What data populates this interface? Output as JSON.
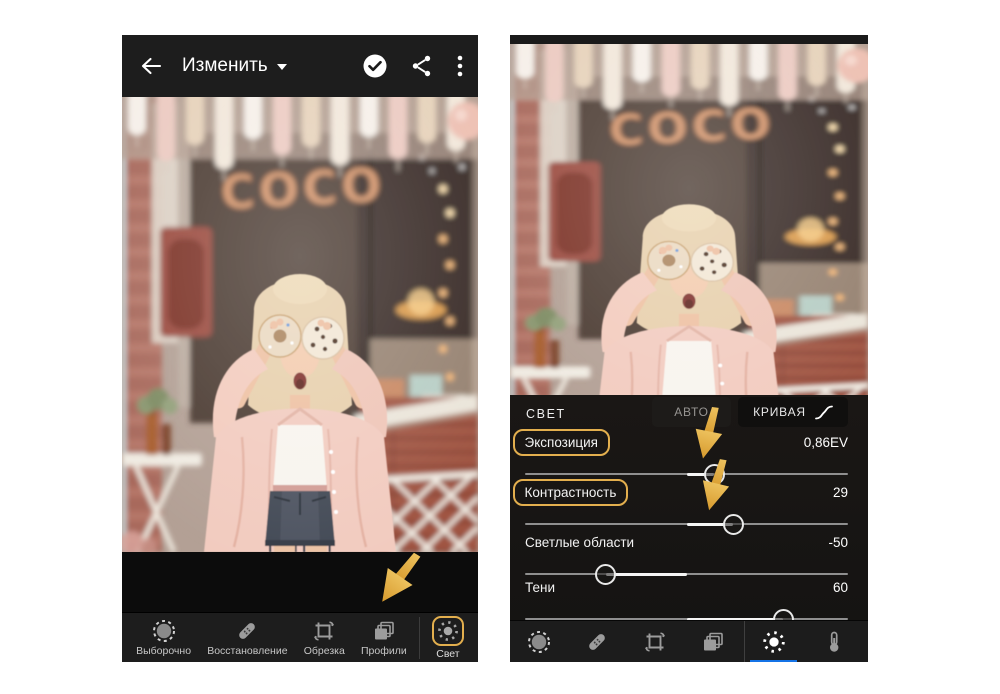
{
  "colors": {
    "accent_gold": "#E3AF4E",
    "selection_blue": "#1473E6"
  },
  "photo": {
    "sign_text": "COCO"
  },
  "left_phone": {
    "top_bar": {
      "title": "Изменить"
    },
    "toolbar": {
      "items": [
        {
          "label": "Выборочно"
        },
        {
          "label": "Восстановление"
        },
        {
          "label": "Обрезка"
        },
        {
          "label": "Профили"
        },
        {
          "label": "Свет",
          "selected": true
        }
      ]
    }
  },
  "right_phone": {
    "panel": {
      "title": "СВЕТ",
      "auto_label": "АВТО",
      "curve_label": "КРИВАЯ",
      "sliders": [
        {
          "label": "Экспозиция",
          "value": "0,86EV",
          "position": 0.172,
          "highlighted": true
        },
        {
          "label": "Контрастность",
          "value": "29",
          "position": 0.29,
          "highlighted": true
        },
        {
          "label": "Светлые области",
          "value": "-50",
          "position": -0.5,
          "highlighted": false
        },
        {
          "label": "Тени",
          "value": "60",
          "position": 0.6,
          "highlighted": false
        }
      ]
    }
  }
}
